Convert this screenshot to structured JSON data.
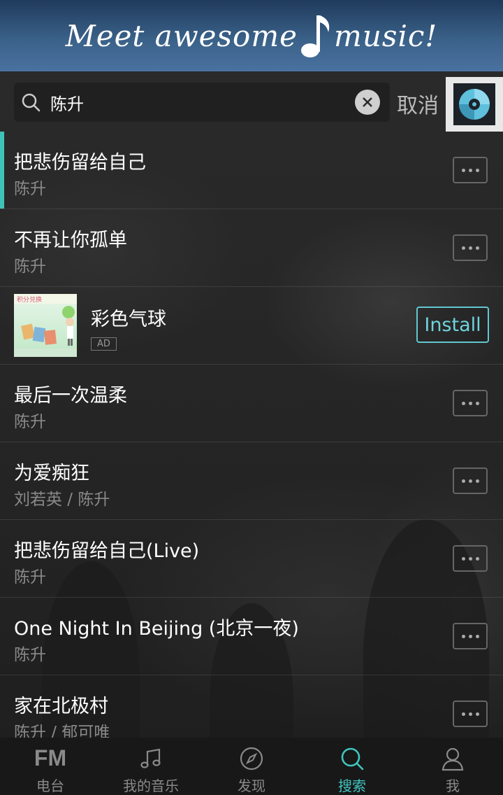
{
  "header": {
    "logo_part1": "Meet awesome",
    "logo_part2": "music!"
  },
  "search": {
    "query": "陈升",
    "cancel_label": "取消"
  },
  "results": [
    {
      "title": "把悲伤留给自己",
      "artist": "陈升",
      "active": true
    },
    {
      "title": "不再让你孤单",
      "artist": "陈升"
    },
    {
      "ad": true,
      "title": "彩色气球",
      "badge": "AD",
      "action": "Install",
      "thumb_text": "积分兑换"
    },
    {
      "title": "最后一次温柔",
      "artist": "陈升"
    },
    {
      "title": "为爱痴狂",
      "artist": "刘若英 / 陈升"
    },
    {
      "title": "把悲伤留给自己(Live)",
      "artist": "陈升"
    },
    {
      "title": "One Night In Beijing (北京一夜)",
      "artist": "陈升"
    },
    {
      "title": "家在北极村",
      "artist": "陈升 / 郁可唯"
    }
  ],
  "nav": {
    "items": [
      {
        "label": "电台",
        "icon": "fm-icon",
        "icon_text": "FM"
      },
      {
        "label": "我的音乐",
        "icon": "music-note-icon"
      },
      {
        "label": "发现",
        "icon": "compass-icon"
      },
      {
        "label": "搜索",
        "icon": "search-icon",
        "active": true
      },
      {
        "label": "我",
        "icon": "user-icon"
      }
    ]
  },
  "colors": {
    "accent": "#40c6c0",
    "header_top": "#1f3a5c",
    "header_bottom": "#4a72a0"
  }
}
